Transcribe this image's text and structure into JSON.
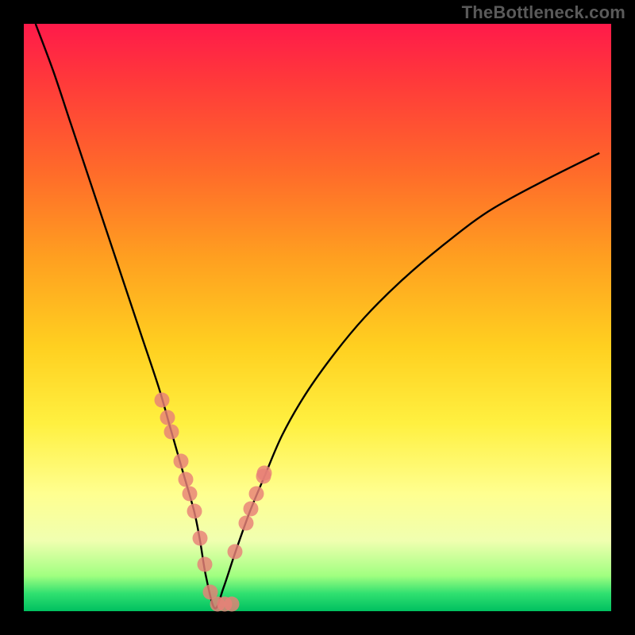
{
  "watermark": "TheBottleneck.com",
  "colors": {
    "background": "#000000",
    "curve": "#000000",
    "marker": "#e88078",
    "watermark_text": "#5a5a5a"
  },
  "chart_data": {
    "type": "line",
    "title": "",
    "xlabel": "",
    "ylabel": "",
    "xlim": [
      0,
      100
    ],
    "ylim": [
      0,
      100
    ],
    "grid": false,
    "series": [
      {
        "name": "bottleneck-curve",
        "x": [
          2,
          5,
          8,
          11,
          14,
          17,
          20,
          23,
          25,
          27,
          29,
          30,
          31,
          32.5,
          34,
          36,
          38.5,
          41,
          44,
          48,
          53,
          58,
          64,
          71,
          79,
          88,
          98
        ],
        "y": [
          100,
          92,
          83,
          74,
          65,
          56,
          47,
          38,
          31,
          24,
          17,
          12,
          6,
          0.5,
          4,
          10,
          17,
          23,
          30,
          37,
          44,
          50,
          56,
          62,
          68,
          73,
          78
        ]
      }
    ],
    "markers": {
      "name": "highlight-dots",
      "x": [
        23.5,
        24.5,
        25.2,
        26.7,
        27.5,
        28.3,
        29.1,
        30.0,
        30.8,
        31.8,
        33.0,
        34.2,
        35.4,
        36.0,
        37.8,
        38.6,
        39.6,
        40.8,
        41.0
      ],
      "y": [
        36.0,
        33.0,
        30.5,
        25.5,
        22.5,
        20.0,
        17.0,
        12.5,
        8.0,
        3.2,
        1.2,
        1.2,
        1.2,
        10.2,
        15.0,
        17.5,
        20.0,
        23.0,
        23.5
      ]
    }
  }
}
